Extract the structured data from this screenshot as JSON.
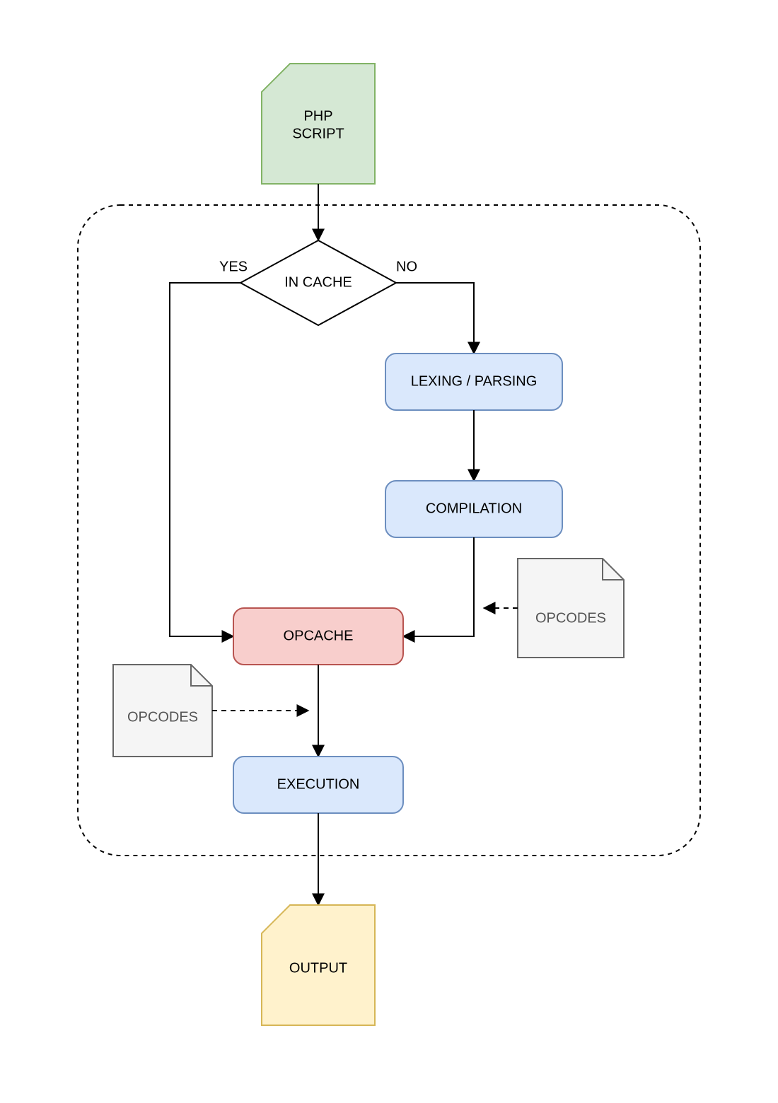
{
  "nodes": {
    "php_script": {
      "line1": "PHP",
      "line2": "SCRIPT"
    },
    "in_cache": {
      "label": "IN CACHE"
    },
    "lexing": {
      "label": "LEXING / PARSING"
    },
    "compilation": {
      "label": "COMPILATION"
    },
    "opcache": {
      "label": "OPCACHE"
    },
    "execution": {
      "label": "EXECUTION"
    },
    "output": {
      "label": "OUTPUT"
    },
    "opcodes_right": {
      "label": "OPCODES"
    },
    "opcodes_left": {
      "label": "OPCODES"
    }
  },
  "edges": {
    "yes": "YES",
    "no": "NO"
  },
  "colors": {
    "green_fill": "#d5e8d4",
    "green_stroke": "#82b366",
    "blue_fill": "#dae8fc",
    "blue_stroke": "#6c8ebf",
    "red_fill": "#f8cecc",
    "red_stroke": "#b85450",
    "yellow_fill": "#fff2cc",
    "yellow_stroke": "#d6b656",
    "file_fill": "#f5f5f5",
    "file_stroke": "#666666"
  }
}
